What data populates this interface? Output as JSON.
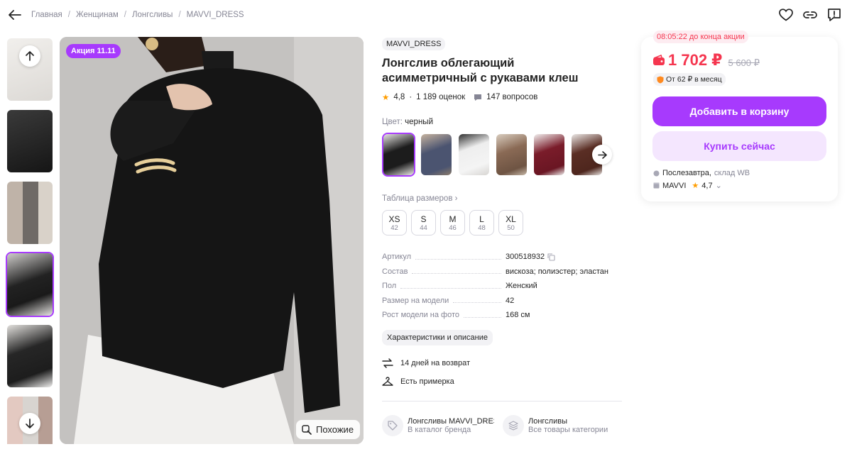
{
  "breadcrumb": [
    "Главная",
    "Женщинам",
    "Лонгсливы",
    "MAVVI_DRESS"
  ],
  "gallery": {
    "promo_badge": "Акция 11.11",
    "similar_label": "Похожие",
    "thumb_colors": [
      "#e9e7e4",
      "#2b2b2b",
      "#a9a49a",
      "#1e1e1e",
      "#d9d8d6",
      "#c9b9b0"
    ]
  },
  "product": {
    "brand": "MAVVI_DRESS",
    "title": "Лонгслив облегающий асимметричный с рукавами клеш",
    "rating": "4,8",
    "reviews": "1 189 оценок",
    "questions": "147 вопросов",
    "color_label": "Цвет:",
    "color_value": "черный",
    "swatch_colors": [
      "#1c1c1c",
      "#4b5470",
      "#eeeeee",
      "#8a6a55",
      "#7a1c2a",
      "#5a2e24"
    ],
    "size_table_label": "Таблица размеров",
    "sizes": [
      {
        "name": "XS",
        "ru": "42"
      },
      {
        "name": "S",
        "ru": "44"
      },
      {
        "name": "M",
        "ru": "46"
      },
      {
        "name": "L",
        "ru": "48"
      },
      {
        "name": "XL",
        "ru": "50"
      }
    ],
    "specs": [
      {
        "key": "Артикул",
        "value": "300518932"
      },
      {
        "key": "Состав",
        "value": "вискоза; полиэстер; эластан"
      },
      {
        "key": "Пол",
        "value": "Женский"
      },
      {
        "key": "Размер на модели",
        "value": "42"
      },
      {
        "key": "Рост модели на фото",
        "value": "168 см"
      }
    ],
    "description_link": "Характеристики и описание",
    "perks": [
      "14 дней на возврат",
      "Есть примерка"
    ],
    "categories": [
      {
        "title": "Лонгсливы MAVVI_DRESS",
        "subtitle": "В каталог бренда"
      },
      {
        "title": "Лонгсливы",
        "subtitle": "Все товары категории"
      }
    ]
  },
  "buy": {
    "timer": "08:05:22",
    "timer_label": "до конца акции",
    "price": "1 702 ₽",
    "old_price": "5 600 ₽",
    "monthly": "От 62 ₽ в месяц",
    "add_to_cart": "Добавить в корзину",
    "buy_now": "Купить сейчас",
    "delivery_place": "Послезавтра,",
    "delivery_source": "склад WB",
    "seller": "MAVVI",
    "seller_rating": "4,7"
  },
  "colors": {
    "accent": "#a73afd",
    "price": "#f5364f",
    "star": "#ff9d00"
  }
}
